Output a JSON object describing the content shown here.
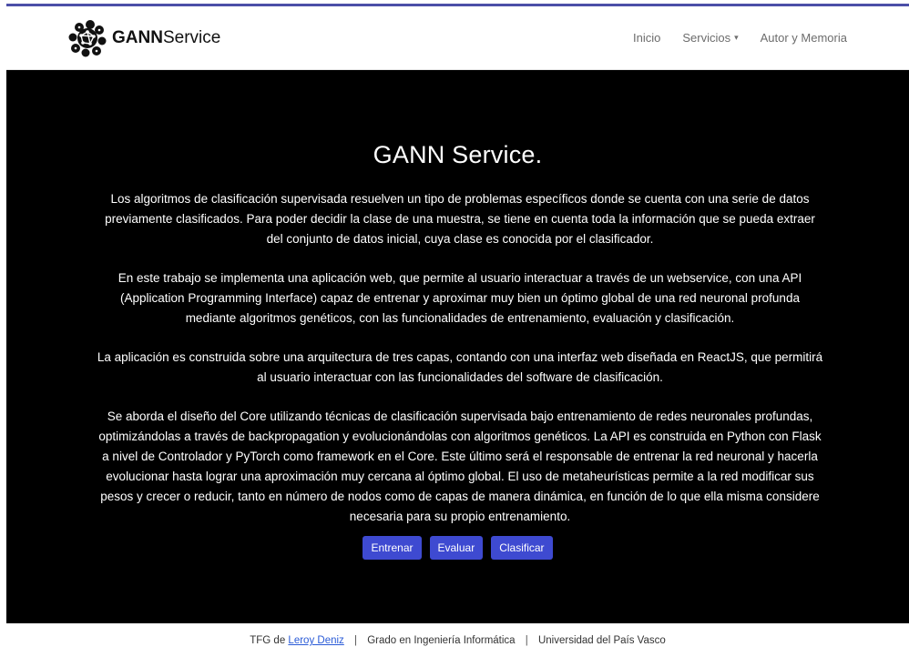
{
  "brand": {
    "name_bold": "GANN",
    "name_rest": "Service",
    "logo_icon": "neural-network-logo-icon"
  },
  "nav": {
    "items": [
      {
        "label": "Inicio"
      },
      {
        "label": "Servicios",
        "caret": "▾"
      },
      {
        "label": "Autor y Memoria"
      }
    ]
  },
  "hero": {
    "title": "GANN Service.",
    "paragraphs": [
      "Los algoritmos de clasificación supervisada resuelven un tipo de problemas específicos donde se cuenta con una serie de datos previamente clasificados. Para poder decidir la clase de una muestra, se tiene en cuenta toda la información que se pueda extraer del conjunto de datos inicial, cuya clase es conocida por el clasificador.",
      "En este trabajo se implementa una aplicación web, que permite al usuario interactuar a través de un webservice, con una API (Application Programming Interface) capaz de entrenar y aproximar muy bien un óptimo global de una red neuronal profunda mediante algoritmos genéticos, con las funcionalidades de entrenamiento, evaluación y clasificación.",
      "La aplicación es construida sobre una arquitectura de tres capas, contando con una interfaz web diseñada en ReactJS, que permitirá al usuario interactuar con las funcionalidades del software de clasificación.",
      "Se aborda el diseño del Core utilizando técnicas de clasificación supervisada bajo entrenamiento de redes neuronales profundas, optimizándolas a través de backpropagation y evolucionándolas con algoritmos genéticos. La API es construida en Python con Flask a nivel de Controlador y PyTorch como framework en el Core. Este último será el responsable de entrenar la red neuronal y hacerla evolucionar hasta lograr una aproximación muy cercana al óptimo global. El uso de metaheurísticas permite a la red modificar sus pesos y crecer o reducir, tanto en número de nodos como de capas de manera dinámica, en función de lo que ella misma considere necesaria para su propio entrenamiento."
    ],
    "buttons": [
      {
        "label": "Entrenar"
      },
      {
        "label": "Evaluar"
      },
      {
        "label": "Clasificar"
      }
    ]
  },
  "footer": {
    "prefix": "TFG de",
    "author_link": "Leroy Deniz",
    "separator": "|",
    "degree": "Grado en Ingeniería Informática",
    "university": "Universidad del País Vasco"
  },
  "colors": {
    "accent": "#3e4ad1",
    "topbar": "#4b4fa8",
    "hero_bg": "#000000",
    "link": "#2a5bd7"
  }
}
